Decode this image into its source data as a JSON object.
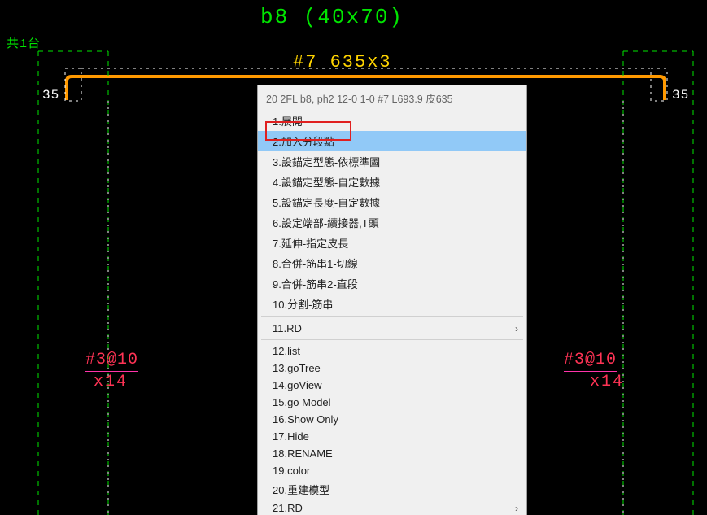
{
  "drawing": {
    "title": "b8 (40x70)",
    "count_label": "共1台",
    "rebar_spec": "#7  635x3",
    "dim_left": "35",
    "dim_right": "35",
    "stirrup_left": {
      "spec": "#3@10",
      "count": "x14"
    },
    "stirrup_right": {
      "spec": "#3@10",
      "count": "x14"
    }
  },
  "menu": {
    "header": "20 2FL b8, ph2 12-0 1-0 #7 L693.9 皮635",
    "highlighted_index": 1,
    "items": [
      {
        "label": "1.展開"
      },
      {
        "label": "2.加入分段點"
      },
      {
        "label": "3.設錨定型態-依標準圖"
      },
      {
        "label": "4.設錨定型態-自定數據"
      },
      {
        "label": "5.設錨定長度-自定數據"
      },
      {
        "label": "6.設定端部-續接器,T頭"
      },
      {
        "label": "7.延伸-指定皮長"
      },
      {
        "label": "8.合併-筋串1-切線"
      },
      {
        "label": "9.合併-筋串2-直段"
      },
      {
        "label": "10.分割-筋串"
      },
      {
        "label": "11.RD",
        "submenu": true
      },
      {
        "label": "12.list"
      },
      {
        "label": "13.goTree"
      },
      {
        "label": "14.goView"
      },
      {
        "label": "15.go Model"
      },
      {
        "label": "16.Show Only"
      },
      {
        "label": "17.Hide"
      },
      {
        "label": "18.RENAME"
      },
      {
        "label": "19.color"
      },
      {
        "label": "20.重建模型"
      },
      {
        "label": "21.RD",
        "submenu": true
      }
    ]
  }
}
